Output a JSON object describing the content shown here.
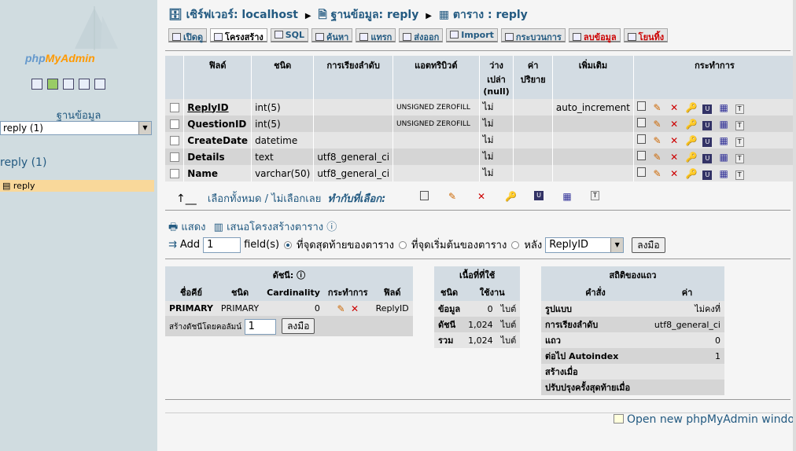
{
  "sidebar": {
    "logo_php": "php",
    "logo_my": "MyAdmin",
    "db_label": "ฐานข้อมูล",
    "db_select": "reply (1)",
    "db_link": "reply (1)",
    "table_item": "reply"
  },
  "breadcrumb": {
    "server": "เซิร์ฟเวอร์: localhost",
    "database": "ฐานข้อมูล: reply",
    "table": "ตาราง : reply"
  },
  "tabs": [
    "เปิดดู",
    "โครงสร้าง",
    "SQL",
    "ค้นหา",
    "แทรก",
    "ส่งออก",
    "Import",
    "กระบวนการ",
    "ลบข้อมูล",
    "โยนทิ้ง"
  ],
  "structure": {
    "headers": [
      "ฟิลด์",
      "ชนิด",
      "การเรียงลำดับ",
      "แอตทริบิวต์",
      "ว่างเปล่า (null)",
      "ค่าปริยาย",
      "เพิ่มเติม",
      "กระทำการ"
    ],
    "rows": [
      {
        "field": "ReplyID",
        "type": "int(5)",
        "collation": "",
        "attributes": "UNSIGNED ZEROFILL",
        "null": "ไม่",
        "default": "",
        "extra": "auto_increment"
      },
      {
        "field": "QuestionID",
        "type": "int(5)",
        "collation": "",
        "attributes": "UNSIGNED ZEROFILL",
        "null": "ไม่",
        "default": "",
        "extra": ""
      },
      {
        "field": "CreateDate",
        "type": "datetime",
        "collation": "",
        "attributes": "",
        "null": "ไม่",
        "default": "",
        "extra": ""
      },
      {
        "field": "Details",
        "type": "text",
        "collation": "utf8_general_ci",
        "attributes": "",
        "null": "ไม่",
        "default": "",
        "extra": ""
      },
      {
        "field": "Name",
        "type": "varchar(50)",
        "collation": "utf8_general_ci",
        "attributes": "",
        "null": "ไม่",
        "default": "",
        "extra": ""
      }
    ]
  },
  "checkall": {
    "label": "เลือกทั้งหมด / ไม่เลือกเลย",
    "with_selected": "ทำกับที่เลือก:"
  },
  "print_row": {
    "print": "แสดง",
    "propose": "เสนอโครงสร้างตาราง"
  },
  "add_row": {
    "add": "Add",
    "count": "1",
    "fields": "field(s)",
    "at_end": "ที่จุดสุดท้ายของตาราง",
    "at_begin": "ที่จุดเริ่มต้นของตาราง",
    "after": "หลัง",
    "after_field": "ReplyID",
    "go": "ลงมือ"
  },
  "indexes": {
    "title": "ดัชนี:",
    "headers": [
      "ชื่อคีย์",
      "ชนิด",
      "Cardinality",
      "กระทำการ",
      "ฟิลด์"
    ],
    "row": {
      "name": "PRIMARY",
      "type": "PRIMARY",
      "cardinality": "0",
      "field": "ReplyID"
    },
    "create_label": "สร้างดัชนีโดยคอลัมน์",
    "create_count": "1",
    "go": "ลงมือ"
  },
  "space": {
    "title": "เนื้อที่ที่ใช้",
    "headers": [
      "ชนิด",
      "ใช้งาน"
    ],
    "rows": [
      {
        "type": "ข้อมูล",
        "value": "0",
        "unit": "ไบต์"
      },
      {
        "type": "ดัชนี",
        "value": "1,024",
        "unit": "ไบต์"
      },
      {
        "type": "รวม",
        "value": "1,024",
        "unit": "ไบต์"
      }
    ]
  },
  "stats": {
    "title": "สถิติของแถว",
    "headers": [
      "คำสั่ง",
      "ค่า"
    ],
    "rows": [
      {
        "label": "รูปแบบ",
        "value": "ไม่คงที่"
      },
      {
        "label": "การเรียงลำดับ",
        "value": "utf8_general_ci"
      },
      {
        "label": "แถว",
        "value": "0"
      },
      {
        "label": "ต่อไป Autoindex",
        "value": "1"
      },
      {
        "label": "สร้างเมื่อ",
        "value": ""
      },
      {
        "label": "ปรับปรุงครั้งสุดท้ายเมื่อ",
        "value": ""
      }
    ]
  },
  "new_window": "Open new phpMyAdmin window",
  "colors": {
    "link": "#235a81",
    "header_bg": "#d3dce3",
    "highlight": "#f9d89a",
    "sidebar_bg": "#d0dce0"
  }
}
